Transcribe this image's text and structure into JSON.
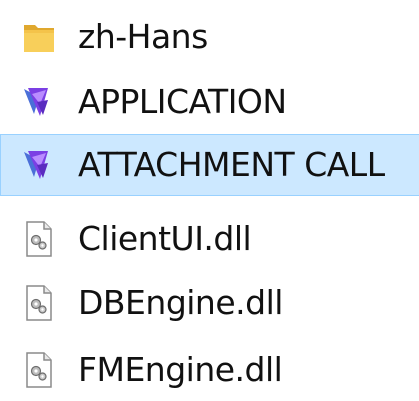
{
  "files": [
    {
      "name": "zh-Hans",
      "icon": "folder-icon",
      "selected": false
    },
    {
      "name": "APPLICATION",
      "icon": "shortcut-app-icon",
      "selected": false
    },
    {
      "name": "ATTACHMENT CALL",
      "icon": "shortcut-app-icon",
      "selected": true
    },
    {
      "name": "ClientUI.dll",
      "icon": "dll-file-icon",
      "selected": false
    },
    {
      "name": "DBEngine.dll",
      "icon": "dll-file-icon",
      "selected": false
    },
    {
      "name": "FMEngine.dll",
      "icon": "dll-file-icon",
      "selected": false
    }
  ],
  "colors": {
    "selection_bg": "#cce8ff",
    "selection_border": "#99d1ff",
    "folder": "#f4c34a",
    "shortcut_purple": "#7b3fe4"
  }
}
